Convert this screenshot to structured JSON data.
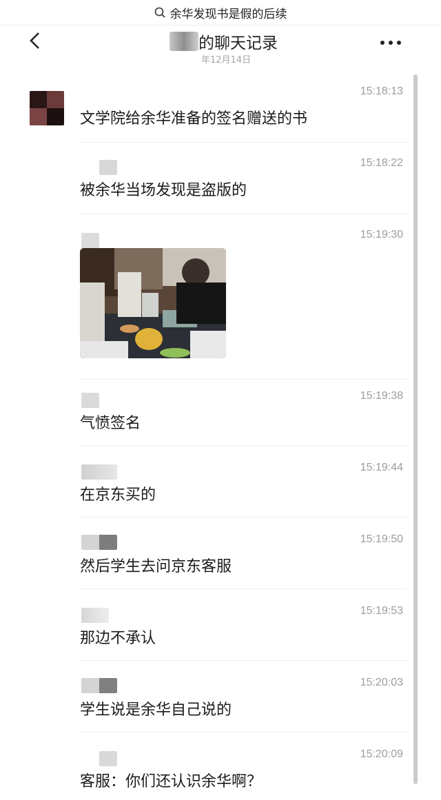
{
  "search": {
    "query": "余华发现书是假的后续",
    "icon": "search-icon"
  },
  "header": {
    "title": "的聊天记录",
    "subtitle": "年12月14日"
  },
  "messages": [
    {
      "time": "15:18:13",
      "text": "文学院给余华准备的签名赠送的书"
    },
    {
      "time": "15:18:22",
      "text": "被余华当场发现是盗版的"
    },
    {
      "time": "15:19:30",
      "text": ""
    },
    {
      "time": "15:19:38",
      "text": "气愤签名"
    },
    {
      "time": "15:19:44",
      "text": "在京东买的"
    },
    {
      "time": "15:19:50",
      "text": "然后学生去问京东客服"
    },
    {
      "time": "15:19:53",
      "text": "那边不承认"
    },
    {
      "time": "15:20:03",
      "text": "学生说是余华自己说的"
    },
    {
      "time": "15:20:09",
      "text": "客服：你们还认识余华啊？"
    }
  ],
  "colors": {
    "text": "#1b1b1b",
    "time": "#9c9c9c",
    "divider": "#efefef"
  }
}
